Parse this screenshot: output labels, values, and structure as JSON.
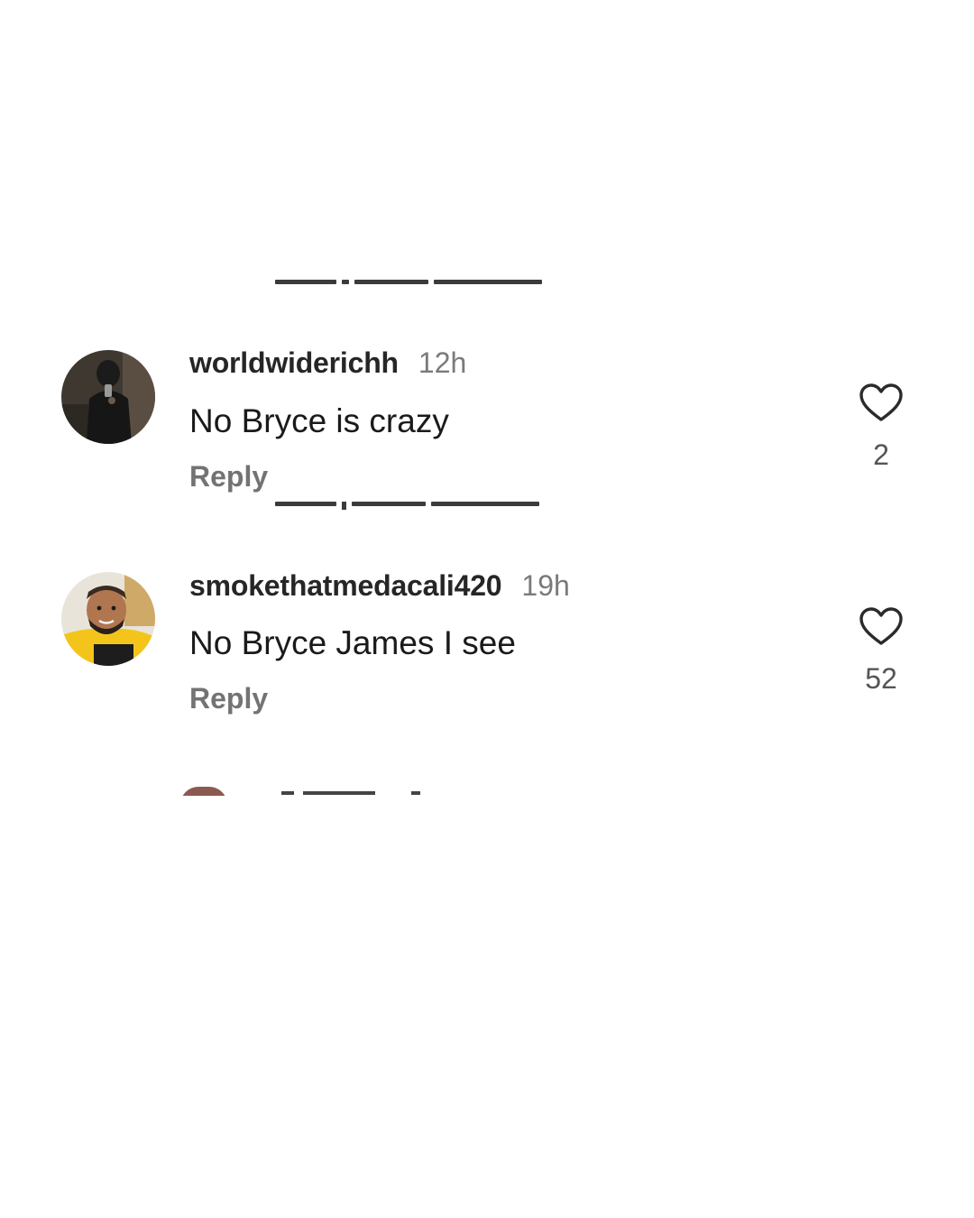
{
  "comments": [
    {
      "username": "worldwiderichh",
      "timestamp": "12h",
      "text": "No Bryce is crazy",
      "reply_label": "Reply",
      "likes": "2",
      "avatar_icon": "user-photo-dark-hoodie"
    },
    {
      "username": "smokethatmedacali420",
      "timestamp": "19h",
      "text": "No Bryce James I see",
      "reply_label": "Reply",
      "likes": "52",
      "avatar_icon": "user-photo-smiling-man"
    }
  ],
  "icons": {
    "like": "heart-outline-icon"
  },
  "colors": {
    "background": "#ffffff",
    "username": "#262626",
    "secondary": "#737373"
  }
}
